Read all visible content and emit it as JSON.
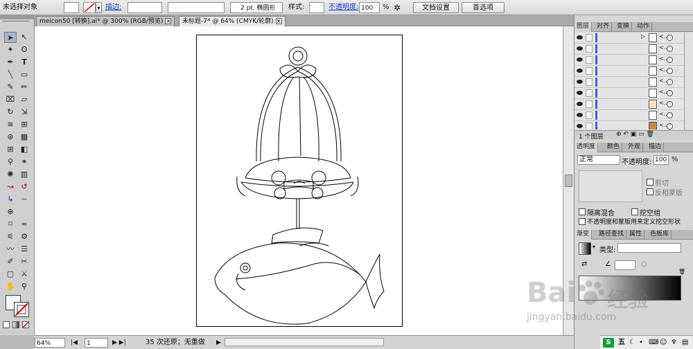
{
  "control_bar": {
    "selection_state": "未选择对象",
    "stroke_label": "描边:",
    "stroke_weight_value": "",
    "brush_value": "",
    "stroke_profile_value": "2 pt. 椭圆形",
    "style_label": "样式:",
    "opacity_label": "不透明度:",
    "opacity_value": "100",
    "percent": "%",
    "doc_setup_button": "文档设置",
    "preferences_button": "首选项"
  },
  "tabs": [
    {
      "label": "meicon50 [转换].ai* @ 300% (RGB/预览)",
      "close": "×"
    },
    {
      "label": "未标题-7* @ 64% (CMYK/轮廓)",
      "close": "×"
    }
  ],
  "status_bar": {
    "zoom": "64%",
    "page": "1",
    "undo_text": "35 次还原；无重做"
  },
  "layers_panel": {
    "tabs": [
      "图层",
      "对齐",
      "变换",
      "动作"
    ],
    "rows": [
      {
        "name": "<...",
        "thumb_color": "#ffffff"
      },
      {
        "name": "<...",
        "thumb_color": "#ffffff"
      },
      {
        "name": "<...",
        "thumb_color": "#ffffff"
      },
      {
        "name": "<...",
        "thumb_color": "#ffffff"
      },
      {
        "name": "<...",
        "thumb_color": "#ffffff"
      },
      {
        "name": "<...",
        "thumb_color": "#ffffff"
      },
      {
        "name": "<...",
        "thumb_color": "#f5e6c8"
      },
      {
        "name": "<...",
        "thumb_color": "#ffffff"
      },
      {
        "name": "<...",
        "thumb_color": "#c88a3a"
      }
    ],
    "count": "1 个图层"
  },
  "transparency_panel": {
    "tabs": [
      "透明度",
      "颜色",
      "外观",
      "描边"
    ],
    "blend_mode": "正常",
    "opacity_label": "不透明度:",
    "opacity_value": "100",
    "percent": "%",
    "clip_label": "剪切",
    "invert_mask_label": "反相蒙版",
    "isolate_blending_label": "隔离混合",
    "knockout_group_label": "挖空组",
    "opacity_mask_label": "不透明度和蒙版用来定义挖空形状"
  },
  "gradient_panel": {
    "tabs": [
      "渐变",
      "路径查找",
      "属性",
      "色板库"
    ],
    "type_label": "类型:",
    "type_value": ""
  },
  "tray": {
    "ime_label": "五"
  },
  "watermark": {
    "brand": "Bai",
    "brand2": "经验",
    "url": "jingyan.baidu.com"
  },
  "colors": {
    "accent_link": "#1a3cc0",
    "layer_color": "#4060d8"
  }
}
